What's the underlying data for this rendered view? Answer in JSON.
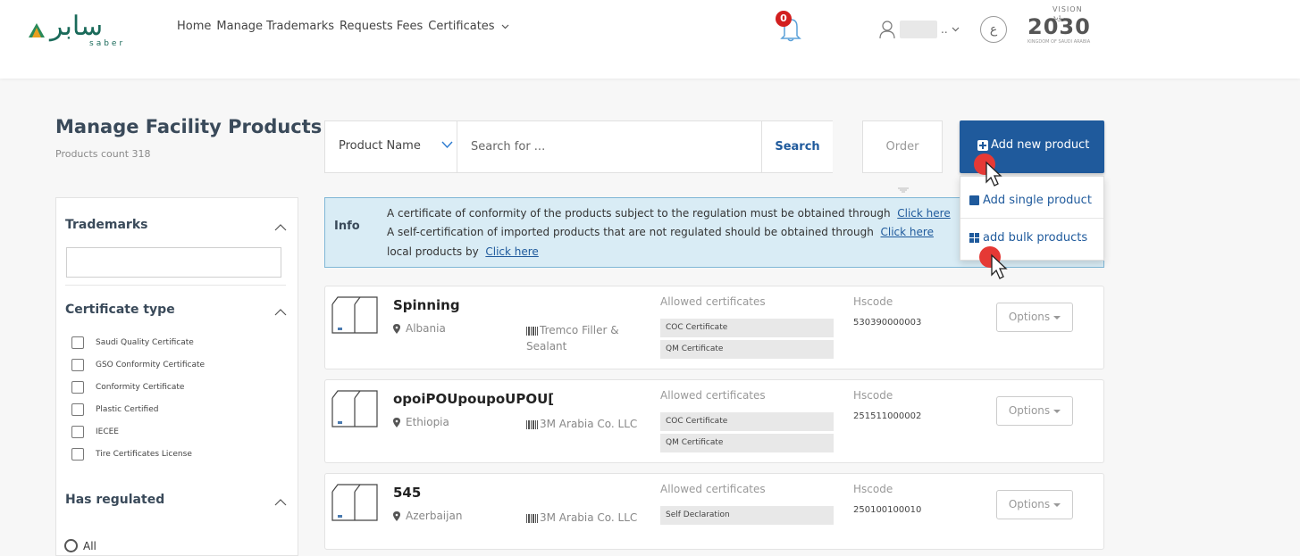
{
  "header": {
    "logo_text_ar": "سابر",
    "logo_text_en": "saber",
    "nav": [
      "Home",
      "Manage Trademarks",
      "Requests Fees",
      "Certificates"
    ],
    "notification_count": "0",
    "language_toggle": "ع",
    "vision_top": "VISION رؤية",
    "vision_num": "2030",
    "vision_sub": "KINGDOM OF SAUDI ARABIA"
  },
  "page": {
    "title": "Manage Facility Products",
    "count_label": "Products count 318"
  },
  "filters": {
    "trademarks_label": "Trademarks",
    "certificate_type_label": "Certificate type",
    "certificate_types": [
      "Saudi Quality Certificate",
      "GSO Conformity Certificate",
      "Conformity Certificate",
      "Plastic Certified",
      "IECEE",
      "Tire Certificates License"
    ],
    "has_regulated_label": "Has regulated",
    "regulated_option": "All"
  },
  "search": {
    "field": "Product Name",
    "placeholder": "Search for ...",
    "button": "Search"
  },
  "actions": {
    "order": "Order",
    "add_new": "Add new product",
    "add_single": "Add single product",
    "add_bulk": "add bulk products"
  },
  "info": {
    "label": "Info",
    "line1": "A certificate of conformity of the products subject to the regulation must be obtained through",
    "line1_link": "Click here",
    "line2": "A self-certification of imported products that are not regulated should be obtained through",
    "line2_link": "Click here",
    "line3": "local products by",
    "line3_link": "Click here"
  },
  "products": [
    {
      "name": "Spinning",
      "country": "Albania",
      "brand": "Tremco Filler & Sealant",
      "certs_label": "Allowed certificates",
      "certs": [
        "COC Certificate",
        "QM Certificate"
      ],
      "hs_label": "Hscode",
      "hscode": "530390000003",
      "options": "Options"
    },
    {
      "name": "opoiPOUpoupoUPOU[",
      "country": "Ethiopia",
      "brand": "3M Arabia Co. LLC",
      "certs_label": "Allowed certificates",
      "certs": [
        "COC Certificate",
        "QM Certificate"
      ],
      "hs_label": "Hscode",
      "hscode": "251511000002",
      "options": "Options"
    },
    {
      "name": "545",
      "country": "Azerbaijan",
      "brand": "3M Arabia Co. LLC",
      "certs_label": "Allowed certificates",
      "certs": [
        "Self Declaration"
      ],
      "hs_label": "Hscode",
      "hscode": "250100100010",
      "options": "Options"
    }
  ],
  "colors": {
    "primary": "#1f5a9c",
    "info_bg": "#d9ecf5",
    "badge": "#d21f1f",
    "cursor_highlight": "#e53935"
  }
}
